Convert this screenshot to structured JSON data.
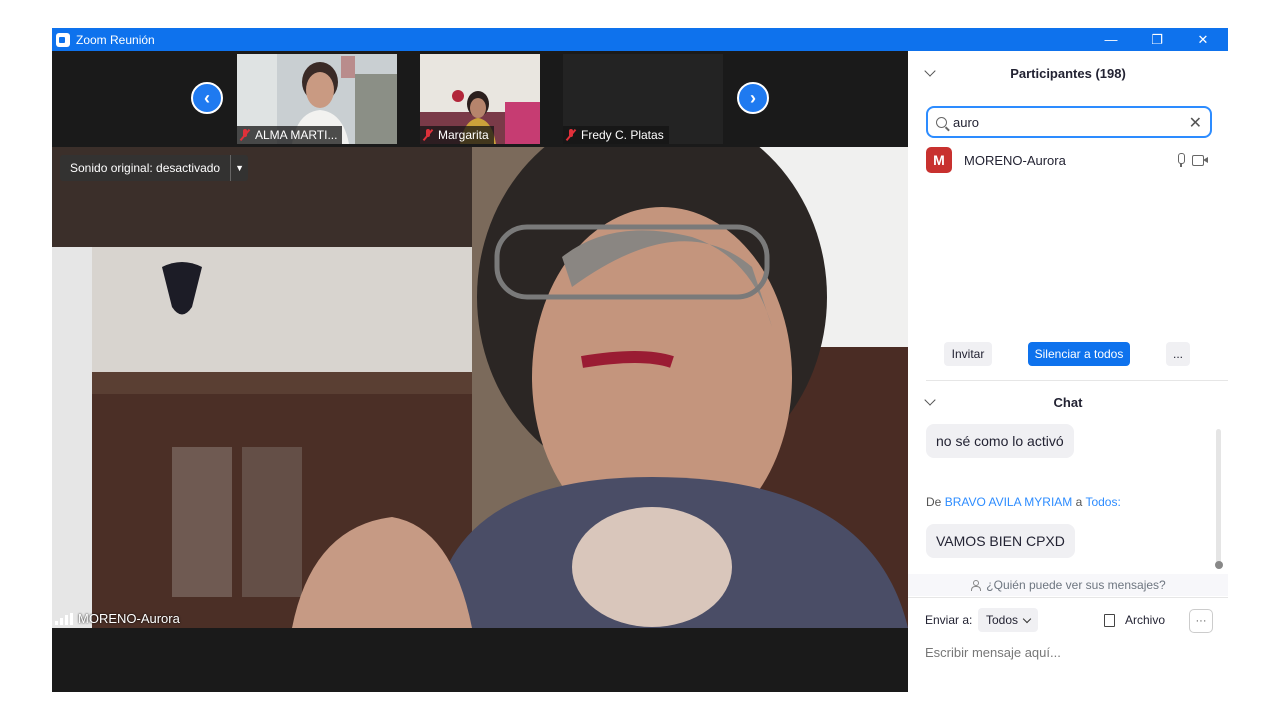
{
  "window": {
    "title": "Zoom Reunión",
    "controls": {
      "minimize": "—",
      "restore": "❐",
      "close": "✕"
    }
  },
  "thumbnails": [
    {
      "name": "ALMA MARTI..."
    },
    {
      "name": "Margarita"
    },
    {
      "name": "Fredy C. Platas"
    }
  ],
  "nav": {
    "prev": "‹",
    "next": "›"
  },
  "main_video": {
    "sound_label": "Sonido original: desactivado",
    "speaker_name": "MORENO-Aurora"
  },
  "participants": {
    "header": "Participantes (198)",
    "search_value": "auro",
    "clear_glyph": "✕",
    "list": [
      {
        "initial": "M",
        "name": "MORENO-Aurora"
      }
    ],
    "invite_label": "Invitar",
    "mute_all_label": "Silenciar a todos",
    "more_label": "..."
  },
  "chat": {
    "header": "Chat",
    "messages": [
      {
        "text": "no sé como lo activó"
      },
      {
        "from_prefix": "De",
        "sender": "BRAVO AVILA MYRIAM",
        "to_word": "a",
        "recipient": "Todos:",
        "text": "VAMOS BIEN CPXD"
      }
    ],
    "who_can_see": "¿Quién puede ver sus mensajes?",
    "send_to_label": "Enviar a:",
    "send_to_value": "Todos",
    "file_label": "Archivo",
    "more_label": "···",
    "compose_placeholder": "Escribir mensaje aquí..."
  },
  "colors": {
    "accent": "#0e72ed",
    "avatar": "#c8312f",
    "link": "#2d8cff"
  }
}
